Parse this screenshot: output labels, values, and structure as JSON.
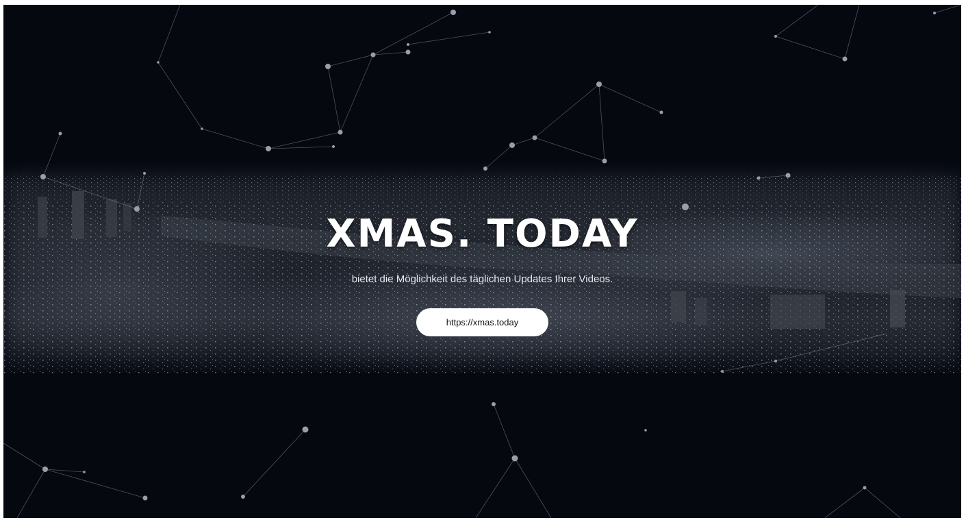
{
  "hero": {
    "title": "XMAS. TODAY",
    "subtitle": "bietet die Möglichkeit des täglichen Updates Ihrer Videos.",
    "button_label": "https://xmas.today"
  },
  "colors": {
    "background": "#05080f",
    "button_bg": "#ffffff",
    "text": "#ffffff",
    "network_line": "#8a8f99",
    "network_node": "#9a9ea6"
  },
  "icons": {
    "background": "city-skyline-night-image",
    "decoration": "particle-network"
  }
}
